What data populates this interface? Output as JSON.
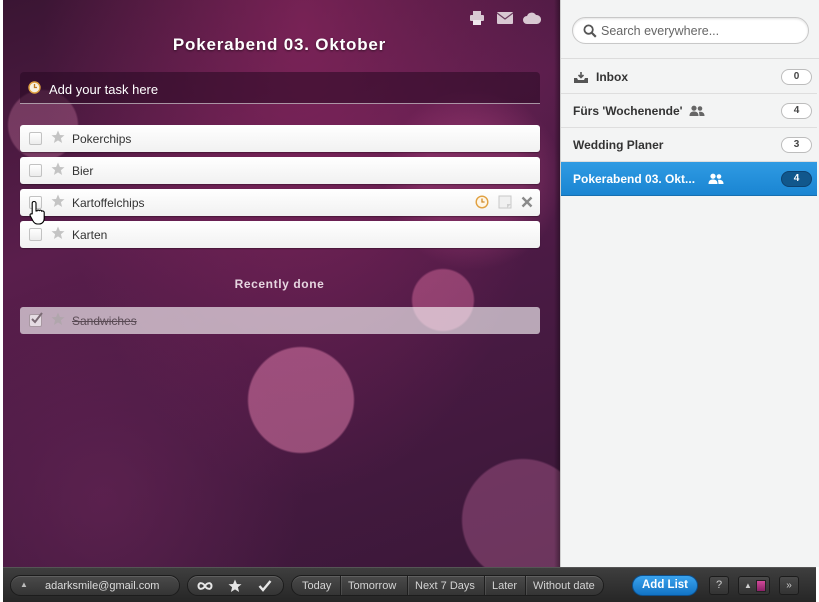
{
  "main": {
    "title": "Pokerabend 03. Oktober",
    "add_task_placeholder": "Add your task here",
    "tasks": [
      {
        "label": "Pokerchips",
        "done": false
      },
      {
        "label": "Bier",
        "done": false
      },
      {
        "label": "Kartoffelchips",
        "done": false
      },
      {
        "label": "Karten",
        "done": false
      }
    ],
    "recently_done_label": "Recently done",
    "done_tasks": [
      {
        "label": "Sandwiches",
        "done": true
      }
    ],
    "top_icons": [
      "print-icon",
      "mail-icon",
      "cloud-icon"
    ],
    "row_tools": [
      "clock-icon",
      "note-icon",
      "delete-icon"
    ]
  },
  "sidebar": {
    "search_placeholder": "Search everywhere...",
    "lists": [
      {
        "label": "Inbox",
        "count": "0",
        "icon": "inbox-icon",
        "shared": false,
        "active": false
      },
      {
        "label": "Fürs 'Wochenende'",
        "count": "4",
        "shared": true,
        "active": false
      },
      {
        "label": "Wedding Planer",
        "count": "3",
        "shared": false,
        "active": false
      },
      {
        "label": "Pokerabend 03. Okt...",
        "count": "4",
        "shared": true,
        "active": true
      }
    ]
  },
  "bottom_bar": {
    "account_email": "adarksmile@gmail.com",
    "filters": [
      "all-icon",
      "starred-icon",
      "done-icon"
    ],
    "date_tabs": [
      "Today",
      "Tomorrow",
      "Next 7 Days",
      "Later",
      "Without date"
    ],
    "add_list_label": "Add List",
    "help_label": "?",
    "more_label": "»"
  },
  "colors": {
    "accent": "#1a85d2",
    "background": "#4a1a44",
    "bottom_bar": "#2e2e2e"
  }
}
